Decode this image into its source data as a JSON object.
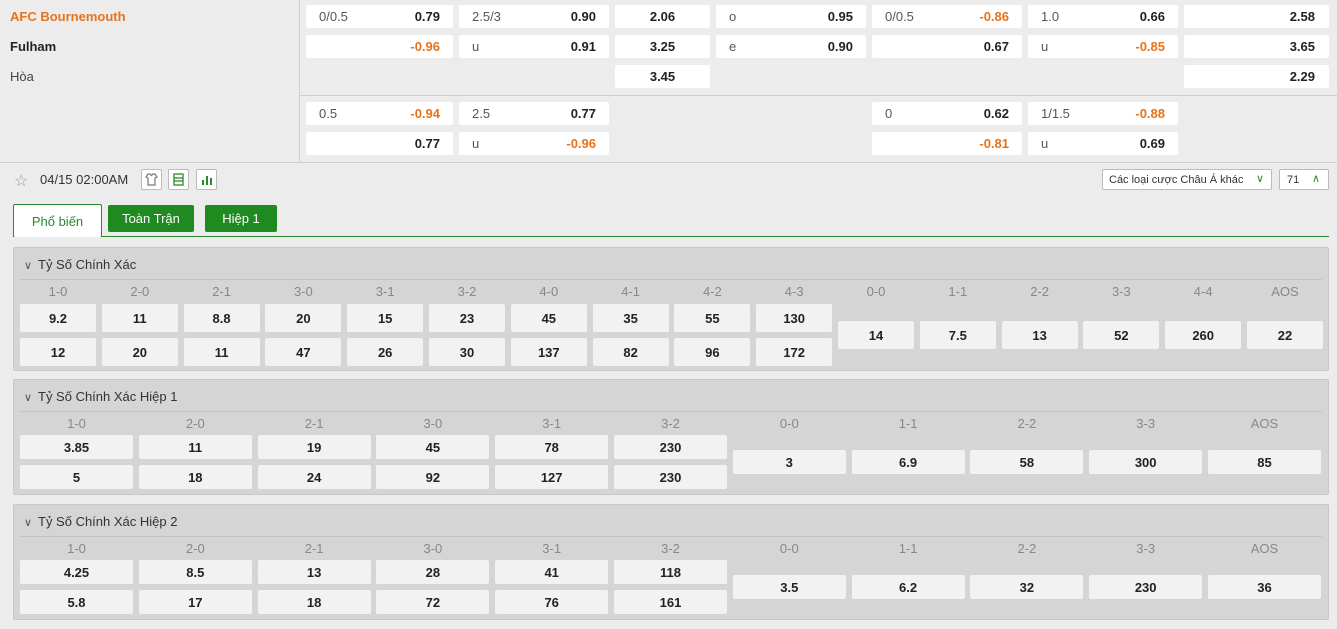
{
  "teams": {
    "home": "AFC Bournemouth",
    "away": "Fulham",
    "draw": "Hòa"
  },
  "odds_top": {
    "r1": {
      "ah_line": "0/0.5",
      "ah_val": "0.79",
      "ou_line": "2.5/3",
      "ou_val": "0.90",
      "x12": "2.06",
      "oe_k": "o",
      "oe_v": "0.95",
      "h1_ah_line": "0/0.5",
      "h1_ah_val": "-0.86",
      "h1_ou_line": "1.0",
      "h1_ou_val": "0.66",
      "h1_x12": "2.58"
    },
    "r2": {
      "ah_val": "-0.96",
      "ou_k": "u",
      "ou_val": "0.91",
      "x12": "3.25",
      "oe_k": "e",
      "oe_v": "0.90",
      "h1_ah_val": "0.67",
      "h1_ou_k": "u",
      "h1_ou_val": "-0.85",
      "h1_x12": "3.65"
    },
    "r3": {
      "x12": "3.45",
      "h1_x12": "2.29"
    },
    "r4": {
      "ah_line": "0.5",
      "ah_val": "-0.94",
      "ou_line": "2.5",
      "ou_val": "0.77",
      "h1_ah_line": "0",
      "h1_ah_val": "0.62",
      "h1_ou_line": "1/1.5",
      "h1_ou_val": "-0.88"
    },
    "r5": {
      "ah_val": "0.77",
      "ou_k": "u",
      "ou_val": "-0.96",
      "h1_ah_val": "-0.81",
      "h1_ou_k": "u",
      "h1_ou_val": "0.69"
    }
  },
  "bar": {
    "time": "04/15 02:00AM",
    "dropdown": "Các loại cược Châu Á khác",
    "count": "71",
    "star_icon": "☆",
    "chevron_down": "∨",
    "chevron_up": "∧"
  },
  "tabs": [
    "Phổ biến",
    "Toàn Trận",
    "Hiệp 1"
  ],
  "panels": [
    {
      "title": "Tỷ Số Chính Xác",
      "labels": [
        "1-0",
        "2-0",
        "2-1",
        "3-0",
        "3-1",
        "3-2",
        "4-0",
        "4-1",
        "4-2",
        "4-3",
        "0-0",
        "1-1",
        "2-2",
        "3-3",
        "4-4",
        "AOS"
      ],
      "home": [
        "9.2",
        "11",
        "8.8",
        "20",
        "15",
        "23",
        "45",
        "35",
        "55",
        "130"
      ],
      "away": [
        "12",
        "20",
        "11",
        "47",
        "26",
        "30",
        "137",
        "82",
        "96",
        "172"
      ],
      "draw": [
        "14",
        "7.5",
        "13",
        "52",
        "260",
        "22"
      ]
    },
    {
      "title": "Tỷ Số Chính Xác Hiệp 1",
      "labels": [
        "1-0",
        "2-0",
        "2-1",
        "3-0",
        "3-1",
        "3-2",
        "0-0",
        "1-1",
        "2-2",
        "3-3",
        "AOS"
      ],
      "home": [
        "3.85",
        "11",
        "19",
        "45",
        "78",
        "230"
      ],
      "away": [
        "5",
        "18",
        "24",
        "92",
        "127",
        "230"
      ],
      "draw": [
        "3",
        "6.9",
        "58",
        "300",
        "85"
      ]
    },
    {
      "title": "Tỷ Số Chính Xác Hiệp 2",
      "labels": [
        "1-0",
        "2-0",
        "2-1",
        "3-0",
        "3-1",
        "3-2",
        "0-0",
        "1-1",
        "2-2",
        "3-3",
        "AOS"
      ],
      "home": [
        "4.25",
        "8.5",
        "13",
        "28",
        "41",
        "118"
      ],
      "away": [
        "5.8",
        "17",
        "18",
        "72",
        "76",
        "161"
      ],
      "draw": [
        "3.5",
        "6.2",
        "32",
        "230",
        "36"
      ]
    }
  ],
  "colors": {
    "accent": "#2a8a2a",
    "negative": "#e8731a",
    "home_team": "#e8731a"
  }
}
